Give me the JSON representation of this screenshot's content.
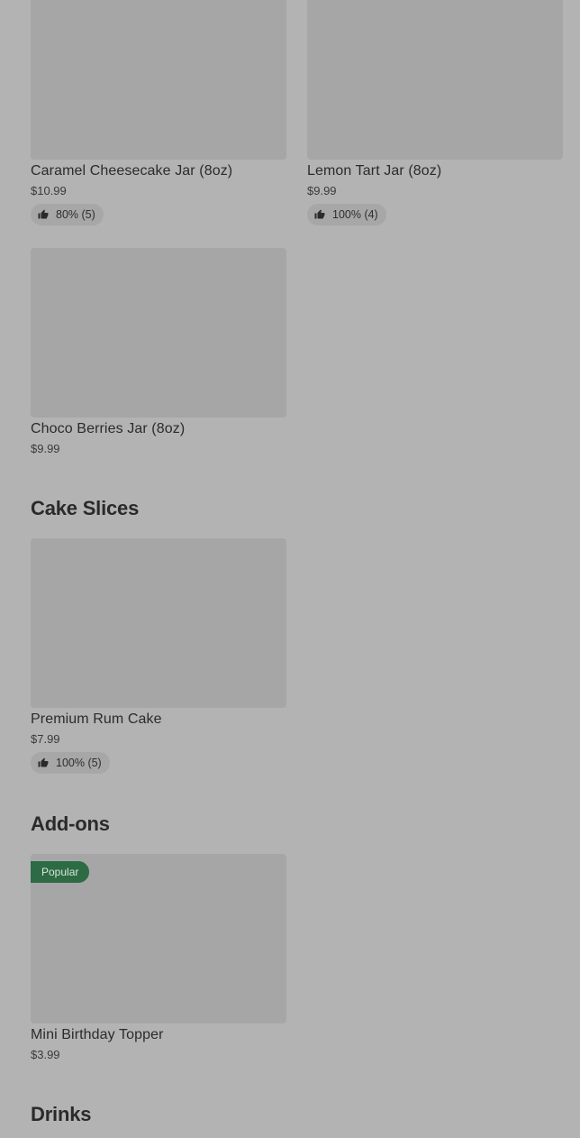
{
  "sections": {
    "cake_slices_title": "Cake Slices",
    "addons_title": "Add-ons",
    "drinks_title": "Drinks"
  },
  "items": {
    "caramel": {
      "name": "Caramel Cheesecake Jar (8oz)",
      "price": "$10.99",
      "rating": "80% (5)"
    },
    "lemon": {
      "name": "Lemon Tart Jar (8oz)",
      "price": "$9.99",
      "rating": "100% (4)"
    },
    "choco": {
      "name": "Choco Berries Jar (8oz)",
      "price": "$9.99"
    },
    "rum": {
      "name": "Premium Rum Cake",
      "price": "$7.99",
      "rating": "100% (5)"
    },
    "topper": {
      "name": "Mini Birthday Topper",
      "price": "$3.99",
      "badge": "Popular"
    }
  },
  "colors": {
    "background": "#b3b3b3",
    "image_placeholder": "#a6a6a6",
    "badge": "#2c6b43"
  },
  "icons": {
    "rating": "thumbs-up-icon"
  }
}
